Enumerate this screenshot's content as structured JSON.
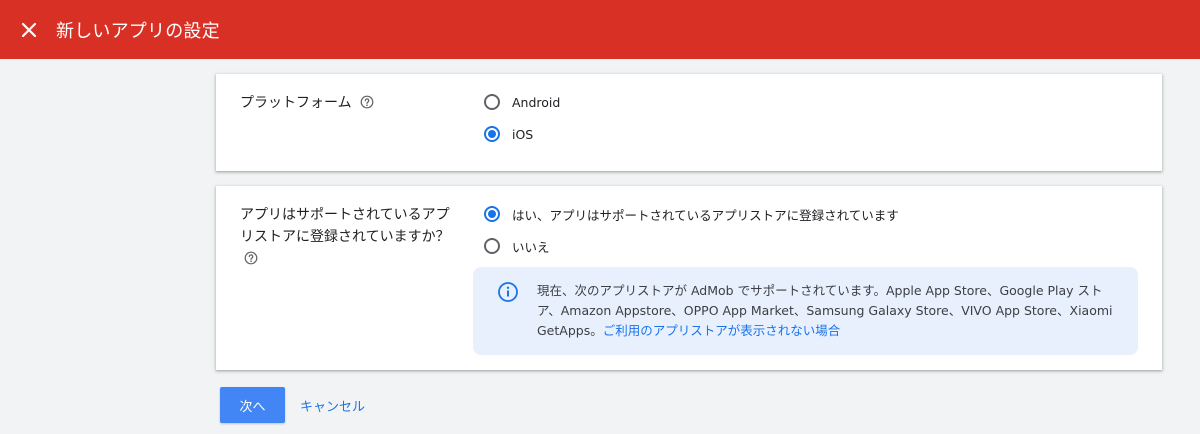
{
  "header": {
    "title": "新しいアプリの設定",
    "close_icon": "close-icon",
    "background_color": "#d93025"
  },
  "platform": {
    "label": "プラットフォーム",
    "help_icon": "help-circle-icon",
    "options": [
      {
        "label": "Android",
        "selected": false
      },
      {
        "label": "iOS",
        "selected": true
      }
    ]
  },
  "store": {
    "label": "アプリはサポートされているアプリストアに登録されていますか？",
    "help_icon": "help-circle-icon",
    "options": [
      {
        "label": "はい、アプリはサポートされているアプリストアに登録されています",
        "selected": true
      },
      {
        "label": "いいえ",
        "selected": false
      }
    ],
    "info": {
      "icon": "info-icon",
      "text": "現在、次のアプリストアが AdMob でサポートされています。Apple App Store、Google Play ストア、Amazon Appstore、OPPO App Market、Samsung Galaxy Store、VIVO App Store、Xiaomi GetApps。",
      "link": "ご利用のアプリストアが表示されない場合"
    }
  },
  "actions": {
    "next_label": "次へ",
    "cancel_label": "キャンセル",
    "accent_color": "#1a73e8"
  }
}
